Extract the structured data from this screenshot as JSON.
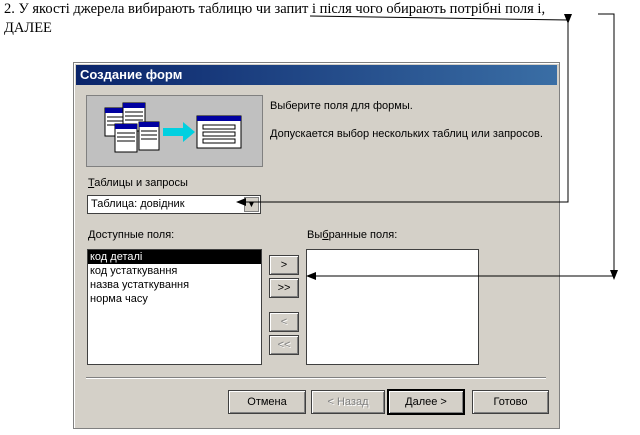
{
  "caption": {
    "line1": "2. У якості джерела вибирають таблицю чи запит і після чого обирають  потрібні поля і,",
    "line2": "ДАЛЕЕ"
  },
  "dialog": {
    "title": "Создание форм",
    "intro_line1": "Выберите поля для формы.",
    "intro_line2": "Допускается выбор нескольких таблиц или запросов.",
    "tables_label_accel": "Т",
    "tables_label_rest": "аблицы и запросы",
    "tables_value": "Таблица: довідник",
    "available_label_accel": "Д",
    "available_label_rest": "оступные поля:",
    "available_fields": [
      "код деталі",
      "код устаткування",
      "назва устаткування",
      "норма часу"
    ],
    "selected_label_pre": "Вы",
    "selected_label_accel": "б",
    "selected_label_rest": "ранные поля:",
    "btn_add": ">",
    "btn_add_all": ">>",
    "btn_remove": "<",
    "btn_remove_all": "<<",
    "btn_cancel": "Отмена",
    "btn_back": "< Назад",
    "btn_next": "Далее >",
    "btn_finish": "Готово"
  },
  "colors": {
    "titlebar_start": "#0a246a",
    "titlebar_end": "#3a6ea5",
    "dialog_face": "#d4d0c8",
    "illustration_cyan": "#00d0e0"
  },
  "icons": {
    "combo_arrow": "chevron-down-icon",
    "illustration": "form-wizard-illustration"
  }
}
